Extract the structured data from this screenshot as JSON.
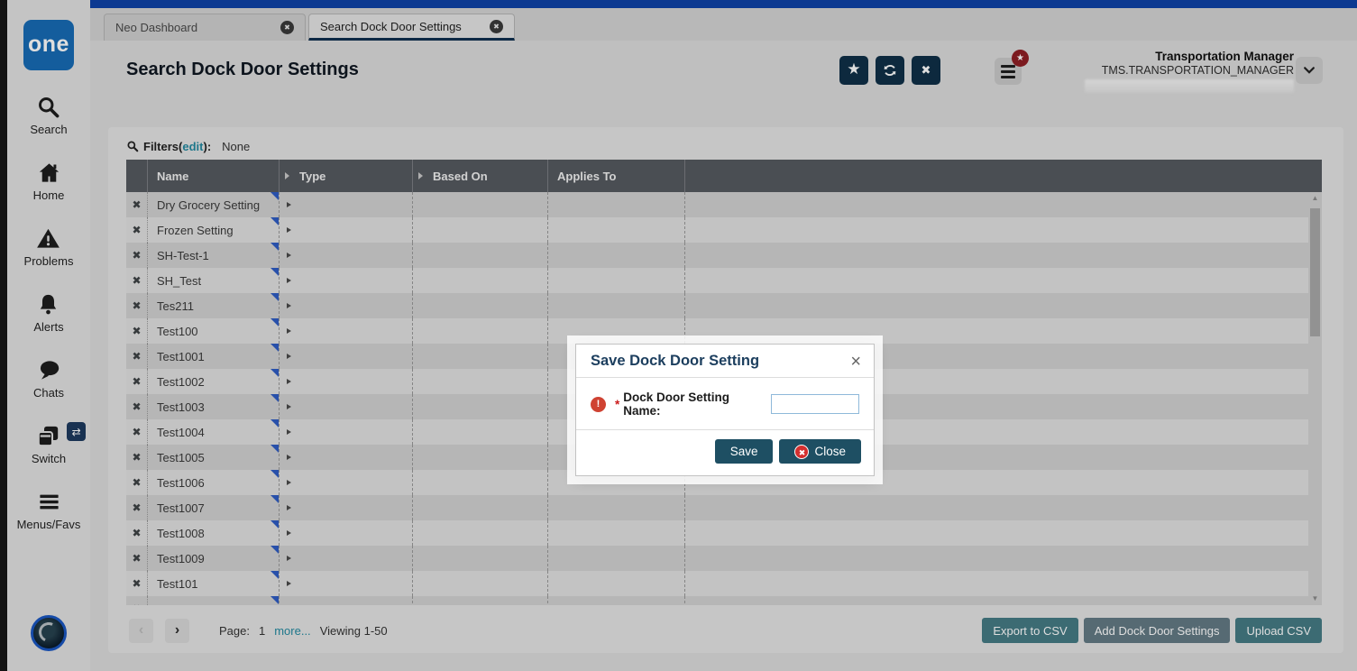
{
  "icons": {
    "star": "★",
    "close_x": "✖",
    "row_remove": "✖",
    "tab_close": "✖",
    "prev": "‹",
    "next": "›",
    "up_arrow": "▲",
    "down_arrow": "▼",
    "switch_badge": "⇄",
    "alert_bang": "!",
    "modal_close": "×",
    "badge_star": "★"
  },
  "sidebar": {
    "logo": "one",
    "items": {
      "search": {
        "label": "Search"
      },
      "home": {
        "label": "Home"
      },
      "problems": {
        "label": "Problems"
      },
      "alerts": {
        "label": "Alerts"
      },
      "chats": {
        "label": "Chats"
      },
      "switch": {
        "label": "Switch"
      },
      "menus": {
        "label": "Menus/Favs"
      }
    }
  },
  "tabs": [
    {
      "label": "Neo Dashboard"
    },
    {
      "label": "Search Dock Door Settings"
    }
  ],
  "header": {
    "title": "Search Dock Door Settings",
    "user_role": "Transportation Manager",
    "user_id": "TMS.TRANSPORTATION_MANAGER"
  },
  "filters": {
    "label": "Filters",
    "paren_open": "(",
    "edit": "edit",
    "paren_close": "):",
    "value": "None"
  },
  "table": {
    "columns": [
      "Name",
      "Type",
      "Based On",
      "Applies To"
    ],
    "rows": [
      "Dry Grocery Setting",
      "Frozen Setting",
      "SH-Test-1",
      "SH_Test",
      "Tes211",
      "Test100",
      "Test1001",
      "Test1002",
      "Test1003",
      "Test1004",
      "Test1005",
      "Test1006",
      "Test1007",
      "Test1008",
      "Test1009",
      "Test101",
      ""
    ]
  },
  "pagination": {
    "page_label": "Page:",
    "page_number": "1",
    "more_link": "more...",
    "viewing": "Viewing 1-50"
  },
  "footer_actions": {
    "export_csv": "Export to CSV",
    "add_settings": "Add Dock Door Settings",
    "upload_csv": "Upload CSV"
  },
  "modal": {
    "title": "Save Dock Door Setting",
    "required_marker": "*",
    "field_label": "Dock Door Setting Name:",
    "input_value": "",
    "save_label": "Save",
    "close_label": "Close"
  },
  "colors": {
    "accent_blue": "#0e42a7",
    "logo_blue": "#176bb5",
    "navy_button": "#103048",
    "grid_header": "#565a60",
    "teal_button": "#457b85",
    "slate_button": "#637a85",
    "modal_button": "#1e4f63",
    "alert_red": "#cf4232",
    "badge_red": "#8f1e24",
    "link_teal": "#2389a0",
    "corner_blue": "#2f5cc4"
  }
}
